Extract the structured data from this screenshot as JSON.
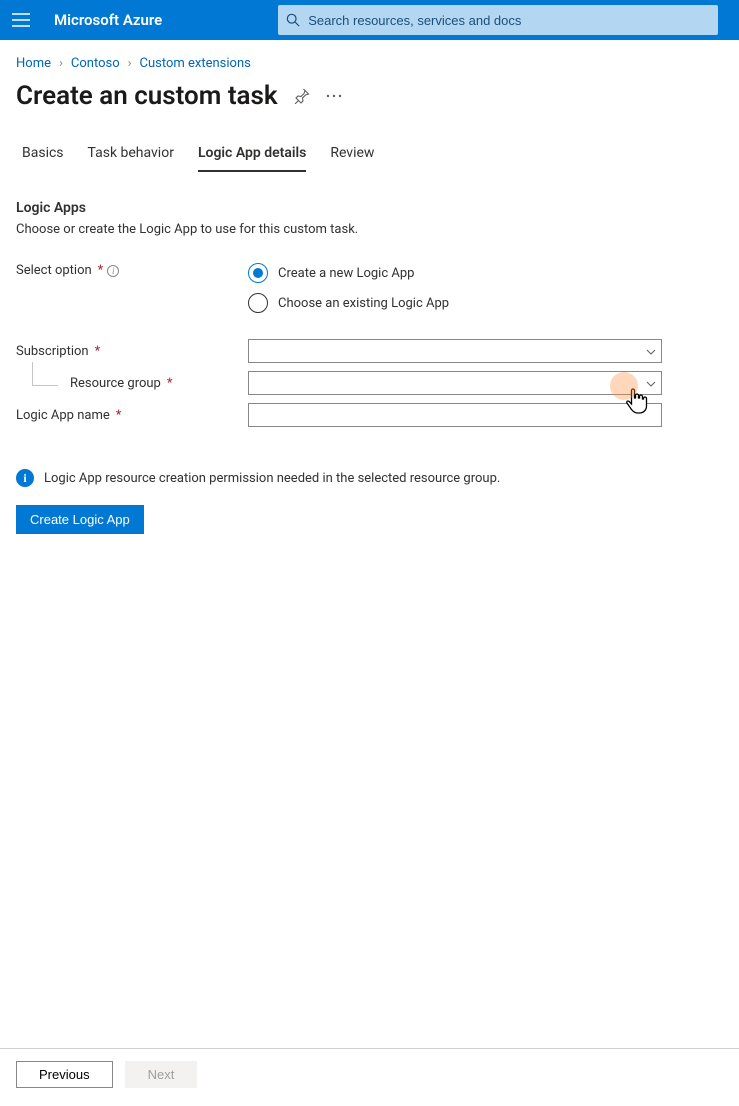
{
  "header": {
    "brand": "Microsoft Azure",
    "search_placeholder": "Search resources, services and docs"
  },
  "breadcrumb": {
    "items": [
      "Home",
      "Contoso",
      "Custom extensions"
    ]
  },
  "page": {
    "title": "Create an custom task"
  },
  "tabs": [
    {
      "label": "Basics",
      "active": false
    },
    {
      "label": "Task behavior",
      "active": false
    },
    {
      "label": "Logic App details",
      "active": true
    },
    {
      "label": "Review",
      "active": false
    }
  ],
  "section": {
    "title": "Logic Apps",
    "description": "Choose or create the Logic App to use for this custom task."
  },
  "form": {
    "select_option_label": "Select option",
    "radio_options": [
      {
        "label": "Create a new Logic App",
        "checked": true
      },
      {
        "label": "Choose an existing Logic App",
        "checked": false
      }
    ],
    "subscription_label": "Subscription",
    "subscription_value": "",
    "resource_group_label": "Resource group",
    "resource_group_value": "",
    "logic_app_name_label": "Logic App name",
    "logic_app_name_value": ""
  },
  "notice": {
    "text": "Logic App resource creation permission needed in the selected resource group."
  },
  "actions": {
    "create_label": "Create Logic App"
  },
  "footer": {
    "previous_label": "Previous",
    "next_label": "Next"
  }
}
